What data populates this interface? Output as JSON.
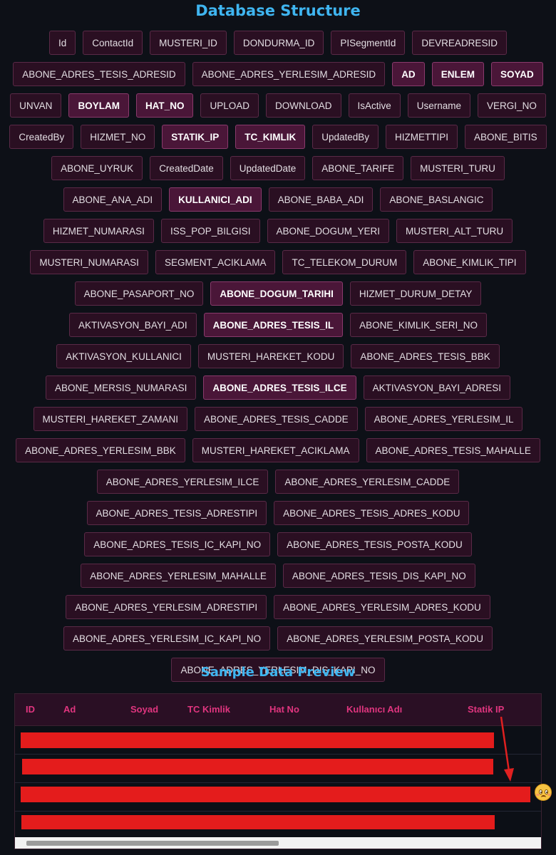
{
  "headings": {
    "db_structure": "Database Structure",
    "sample_preview": "Sample Data Preview"
  },
  "fields": [
    {
      "label": "Id",
      "hl": false
    },
    {
      "label": "ContactId",
      "hl": false
    },
    {
      "label": "MUSTERI_ID",
      "hl": false
    },
    {
      "label": "DONDURMA_ID",
      "hl": false
    },
    {
      "label": "PISegmentId",
      "hl": false
    },
    {
      "label": "DEVREADRESID",
      "hl": false
    },
    {
      "label": "ABONE_ADRES_TESIS_ADRESID",
      "hl": false
    },
    {
      "label": "ABONE_ADRES_YERLESIM_ADRESID",
      "hl": false
    },
    {
      "label": "AD",
      "hl": true
    },
    {
      "label": "ENLEM",
      "hl": true
    },
    {
      "label": "SOYAD",
      "hl": true
    },
    {
      "label": "UNVAN",
      "hl": false
    },
    {
      "label": "BOYLAM",
      "hl": true
    },
    {
      "label": "HAT_NO",
      "hl": true
    },
    {
      "label": "UPLOAD",
      "hl": false
    },
    {
      "label": "DOWNLOAD",
      "hl": false
    },
    {
      "label": "IsActive",
      "hl": false
    },
    {
      "label": "Username",
      "hl": false
    },
    {
      "label": "VERGI_NO",
      "hl": false
    },
    {
      "label": "CreatedBy",
      "hl": false
    },
    {
      "label": "HIZMET_NO",
      "hl": false
    },
    {
      "label": "STATIK_IP",
      "hl": true
    },
    {
      "label": "TC_KIMLIK",
      "hl": true
    },
    {
      "label": "UpdatedBy",
      "hl": false
    },
    {
      "label": "HIZMETTIPI",
      "hl": false
    },
    {
      "label": "ABONE_BITIS",
      "hl": false
    },
    {
      "label": "ABONE_UYRUK",
      "hl": false
    },
    {
      "label": "CreatedDate",
      "hl": false
    },
    {
      "label": "UpdatedDate",
      "hl": false
    },
    {
      "label": "ABONE_TARIFE",
      "hl": false
    },
    {
      "label": "MUSTERI_TURU",
      "hl": false
    },
    {
      "label": "ABONE_ANA_ADI",
      "hl": false
    },
    {
      "label": "KULLANICI_ADI",
      "hl": true
    },
    {
      "label": "ABONE_BABA_ADI",
      "hl": false
    },
    {
      "label": "ABONE_BASLANGIC",
      "hl": false
    },
    {
      "label": "HIZMET_NUMARASI",
      "hl": false
    },
    {
      "label": "ISS_POP_BILGISI",
      "hl": false
    },
    {
      "label": "ABONE_DOGUM_YERI",
      "hl": false
    },
    {
      "label": "MUSTERI_ALT_TURU",
      "hl": false
    },
    {
      "label": "MUSTERI_NUMARASI",
      "hl": false
    },
    {
      "label": "SEGMENT_ACIKLAMA",
      "hl": false
    },
    {
      "label": "TC_TELEKOM_DURUM",
      "hl": false
    },
    {
      "label": "ABONE_KIMLIK_TIPI",
      "hl": false
    },
    {
      "label": "ABONE_PASAPORT_NO",
      "hl": false
    },
    {
      "label": "ABONE_DOGUM_TARIHI",
      "hl": true
    },
    {
      "label": "HIZMET_DURUM_DETAY",
      "hl": false
    },
    {
      "label": "AKTIVASYON_BAYI_ADI",
      "hl": false
    },
    {
      "label": "ABONE_ADRES_TESIS_IL",
      "hl": true
    },
    {
      "label": "ABONE_KIMLIK_SERI_NO",
      "hl": false
    },
    {
      "label": "AKTIVASYON_KULLANICI",
      "hl": false
    },
    {
      "label": "MUSTERI_HAREKET_KODU",
      "hl": false
    },
    {
      "label": "ABONE_ADRES_TESIS_BBK",
      "hl": false
    },
    {
      "label": "ABONE_MERSIS_NUMARASI",
      "hl": false
    },
    {
      "label": "ABONE_ADRES_TESIS_ILCE",
      "hl": true
    },
    {
      "label": "AKTIVASYON_BAYI_ADRESI",
      "hl": false
    },
    {
      "label": "MUSTERI_HAREKET_ZAMANI",
      "hl": false
    },
    {
      "label": "ABONE_ADRES_TESIS_CADDE",
      "hl": false
    },
    {
      "label": "ABONE_ADRES_YERLESIM_IL",
      "hl": false
    },
    {
      "label": "ABONE_ADRES_YERLESIM_BBK",
      "hl": false
    },
    {
      "label": "MUSTERI_HAREKET_ACIKLAMA",
      "hl": false
    },
    {
      "label": "ABONE_ADRES_TESIS_MAHALLE",
      "hl": false
    },
    {
      "label": "ABONE_ADRES_YERLESIM_ILCE",
      "hl": false
    },
    {
      "label": "ABONE_ADRES_YERLESIM_CADDE",
      "hl": false
    },
    {
      "label": "ABONE_ADRES_TESIS_ADRESTIPI",
      "hl": false
    },
    {
      "label": "ABONE_ADRES_TESIS_ADRES_KODU",
      "hl": false
    },
    {
      "label": "ABONE_ADRES_TESIS_IC_KAPI_NO",
      "hl": false
    },
    {
      "label": "ABONE_ADRES_TESIS_POSTA_KODU",
      "hl": false
    },
    {
      "label": "ABONE_ADRES_YERLESIM_MAHALLE",
      "hl": false
    },
    {
      "label": "ABONE_ADRES_TESIS_DIS_KAPI_NO",
      "hl": false
    },
    {
      "label": "ABONE_ADRES_YERLESIM_ADRESTIPI",
      "hl": false
    },
    {
      "label": "ABONE_ADRES_YERLESIM_ADRES_KODU",
      "hl": false
    },
    {
      "label": "ABONE_ADRES_YERLESIM_IC_KAPI_NO",
      "hl": false
    },
    {
      "label": "ABONE_ADRES_YERLESIM_POSTA_KODU",
      "hl": false
    },
    {
      "label": "ABONE_ADRES_YERLESIM_DIS_KAPI_NO",
      "hl": false
    }
  ],
  "table": {
    "columns": [
      "ID",
      "Ad",
      "Soyad",
      "TC Kimlik",
      "Hat No",
      "Kullanıcı Adı",
      "Statik IP"
    ]
  },
  "colors": {
    "heading": "#3fb5f0",
    "tag_bg": "#2a0f22",
    "tag_highlight_bg": "#4a1638",
    "column_header": "#e0357f",
    "redaction": "#e41c1c"
  },
  "icons": {
    "annotation_arrow": "arrow-icon",
    "reaction": "flushed-face-emoji-icon"
  }
}
